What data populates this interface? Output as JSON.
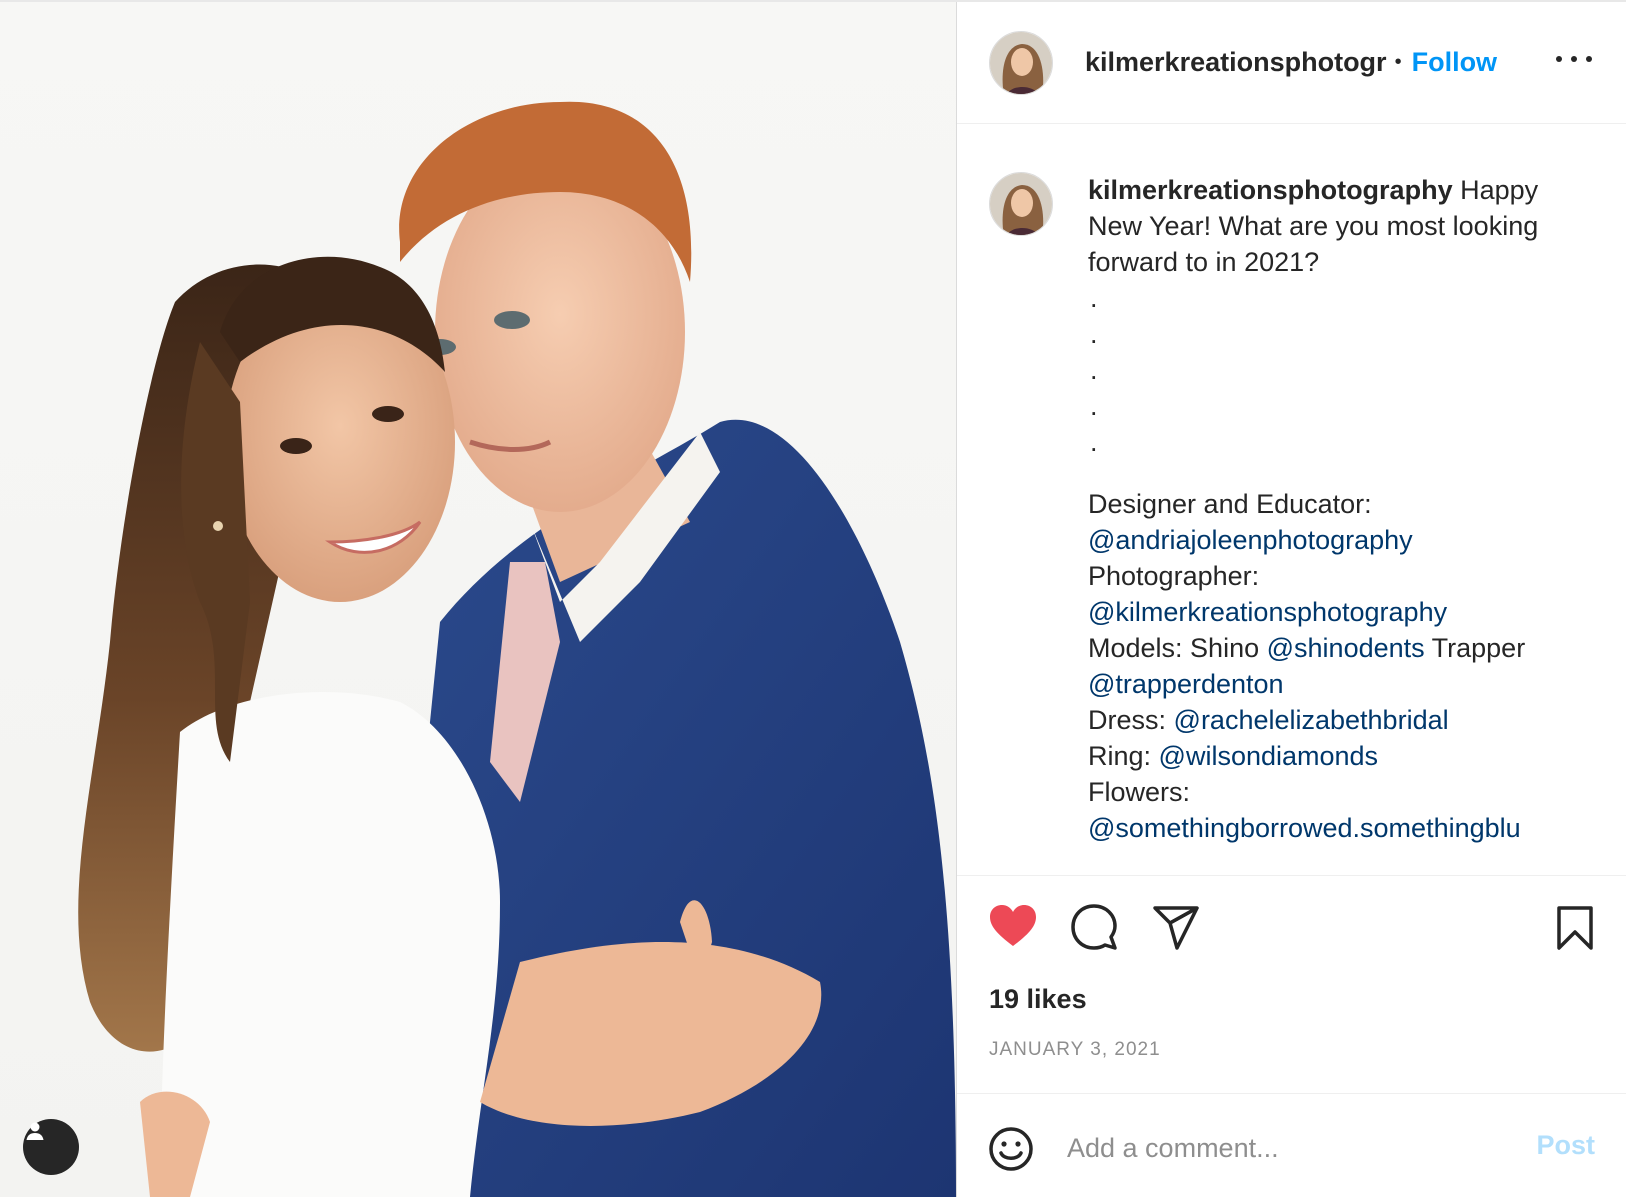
{
  "post": {
    "author_short": "kilmerkreationsphotogr",
    "separator": "•",
    "follow_label": "Follow",
    "more_icon": "more-horizontal-icon"
  },
  "caption": {
    "author": "kilmerkreationsphotography",
    "line1_rest": "Happy",
    "line2": "New Year! What are you most looking",
    "line3": "forward to in 2021?",
    "dots": [
      ".",
      ".",
      ".",
      ".",
      "."
    ],
    "designer_label": "Designer and Educator:",
    "designer_handle": "@andriajoleenphotography",
    "photographer_label": "Photographer:",
    "photographer_handle": "@kilmerkreationsphotography",
    "models_label": "Models: Shino",
    "model1_handle": "@shinodents",
    "models_mid": "Trapper",
    "model2_handle": "@trapperdenton",
    "dress_label": "Dress:",
    "dress_handle": "@rachelelizabethbridal",
    "ring_label": "Ring:",
    "ring_handle": "@wilsondiamonds",
    "flowers_label": "Flowers:",
    "flowers_handle": "@somethingborrowed.somethingblu"
  },
  "actions": {
    "like_icon": "heart-filled-icon",
    "like_color": "#ed4956",
    "comment_icon": "comment-icon",
    "share_icon": "share-icon",
    "save_icon": "bookmark-icon"
  },
  "likes": "19 likes",
  "date": "JANUARY 3, 2021",
  "comment_box": {
    "placeholder": "Add a comment...",
    "post_label": "Post",
    "post_color": "#b2dffc"
  },
  "photo": {
    "tag_icon": "user-tag-icon"
  }
}
